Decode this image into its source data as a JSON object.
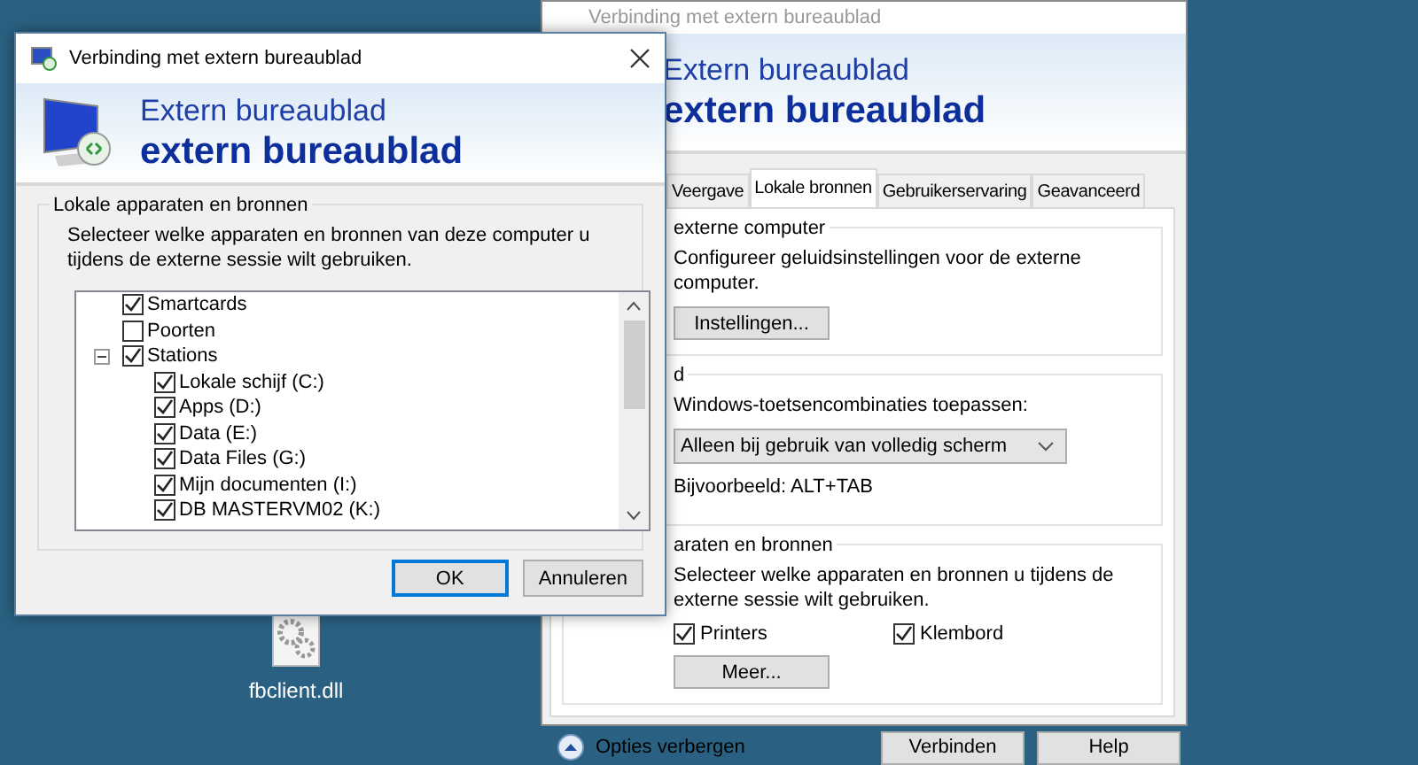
{
  "desktop_icons": [
    {
      "label": "fbclient.dll"
    }
  ],
  "back_window": {
    "title": "Verbinding met extern bureaublad",
    "header_line_1": "Extern bureaublad",
    "header_line_2": "extern bureaublad",
    "tabs": [
      {
        "label": "Veergave",
        "selected": false
      },
      {
        "label": "Lokale bronnen",
        "selected": true
      },
      {
        "label": "Gebruikerservaring",
        "selected": false
      },
      {
        "label": "Geavanceerd",
        "selected": false
      }
    ],
    "audio_group": {
      "legend": "externe computer",
      "description": "Configureer geluidsinstellingen voor de externe computer.",
      "button": "Instellingen..."
    },
    "keyboard_group": {
      "legend": "d",
      "label": "Windows-toetsencombinaties toepassen:",
      "dropdown_value": "Alleen bij gebruik van volledig scherm",
      "example": "Bijvoorbeeld: ALT+TAB"
    },
    "devices_group": {
      "legend": "araten en bronnen",
      "description": "Selecteer welke apparaten en bronnen u tijdens de externe sessie wilt gebruiken.",
      "checkboxes": [
        {
          "label": "Printers",
          "checked": true
        },
        {
          "label": "Klembord",
          "checked": true
        }
      ],
      "button": "Meer..."
    },
    "options_toggle": "Opties verbergen",
    "buttons": [
      {
        "label": "Verbinden"
      },
      {
        "label": "Help"
      }
    ]
  },
  "dialog": {
    "title": "Verbinding met extern bureaublad",
    "header_line_1": "Extern bureaublad",
    "header_line_2": "extern bureaublad",
    "group_legend": "Lokale apparaten en bronnen",
    "description": "Selecteer welke apparaten en bronnen van deze computer u tijdens de externe sessie wilt gebruiken.",
    "tree": [
      {
        "label": "Smartcards",
        "checked": true
      },
      {
        "label": "Poorten",
        "checked": false
      },
      {
        "label": "Stations",
        "checked": true,
        "expanded": true,
        "children": [
          {
            "label": "Lokale schijf (C:)",
            "checked": true
          },
          {
            "label": "Apps (D:)",
            "checked": true
          },
          {
            "label": "Data (E:)",
            "checked": true
          },
          {
            "label": "Data Files (G:)",
            "checked": true
          },
          {
            "label": "Mijn documenten (I:)",
            "checked": true
          },
          {
            "label": "DB MASTERVM02 (K:)",
            "checked": true
          }
        ]
      }
    ],
    "buttons": [
      {
        "label": "OK",
        "default": true
      },
      {
        "label": "Annuleren",
        "default": false
      }
    ]
  }
}
